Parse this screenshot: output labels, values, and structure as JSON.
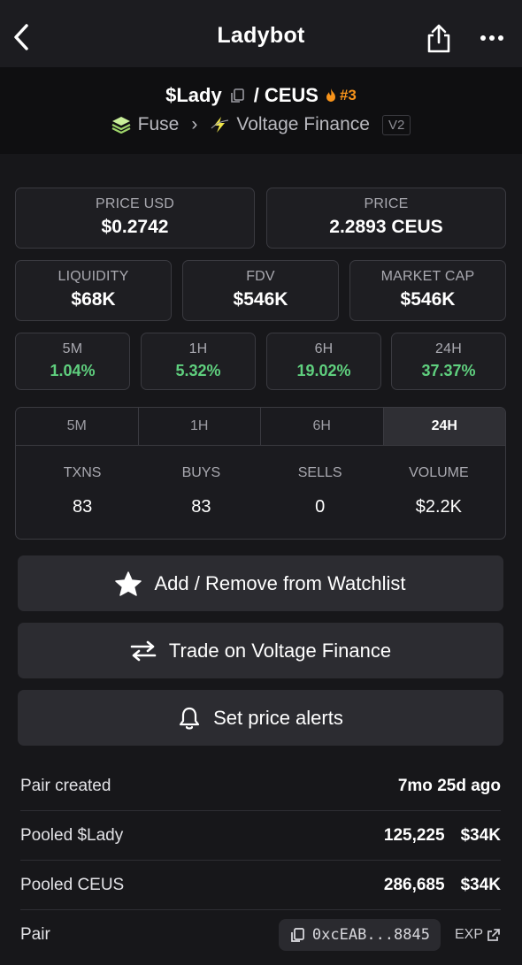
{
  "header": {
    "title": "Ladybot"
  },
  "pair": {
    "base": "$Lady",
    "separator": "/",
    "quote": "CEUS",
    "rank": "#3",
    "chain": "Fuse",
    "dex": "Voltage Finance",
    "dex_version": "V2"
  },
  "price_cards": [
    {
      "label": "PRICE USD",
      "value": "$0.2742"
    },
    {
      "label": "PRICE",
      "value": "2.2893 CEUS"
    }
  ],
  "metric_cards": [
    {
      "label": "LIQUIDITY",
      "value": "$68K"
    },
    {
      "label": "FDV",
      "value": "$546K"
    },
    {
      "label": "MARKET CAP",
      "value": "$546K"
    }
  ],
  "change_cards": [
    {
      "label": "5M",
      "value": "1.04%"
    },
    {
      "label": "1H",
      "value": "5.32%"
    },
    {
      "label": "6H",
      "value": "19.02%"
    },
    {
      "label": "24H",
      "value": "37.37%"
    }
  ],
  "colors": {
    "positive": "#5fcf7e",
    "rank": "#f7931a",
    "background": "#17171a"
  },
  "txn_tabs": [
    "5M",
    "1H",
    "6H",
    "24H"
  ],
  "txn_active_tab": "24H",
  "txn_stats": [
    {
      "label": "TXNS",
      "value": "83"
    },
    {
      "label": "BUYS",
      "value": "83"
    },
    {
      "label": "SELLS",
      "value": "0"
    },
    {
      "label": "VOLUME",
      "value": "$2.2K"
    }
  ],
  "actions": {
    "watchlist": "Add / Remove from Watchlist",
    "trade": "Trade on Voltage Finance",
    "alerts": "Set price alerts"
  },
  "info": {
    "pair_created_label": "Pair created",
    "pair_created_value": "7mo 25d ago",
    "pooled_base_label": "Pooled $Lady",
    "pooled_base_amount": "125,225",
    "pooled_base_usd": "$34K",
    "pooled_quote_label": "Pooled CEUS",
    "pooled_quote_amount": "286,685",
    "pooled_quote_usd": "$34K",
    "pair_label": "Pair",
    "pair_address": "0xcEAB...8845",
    "explorer_label": "EXP"
  }
}
